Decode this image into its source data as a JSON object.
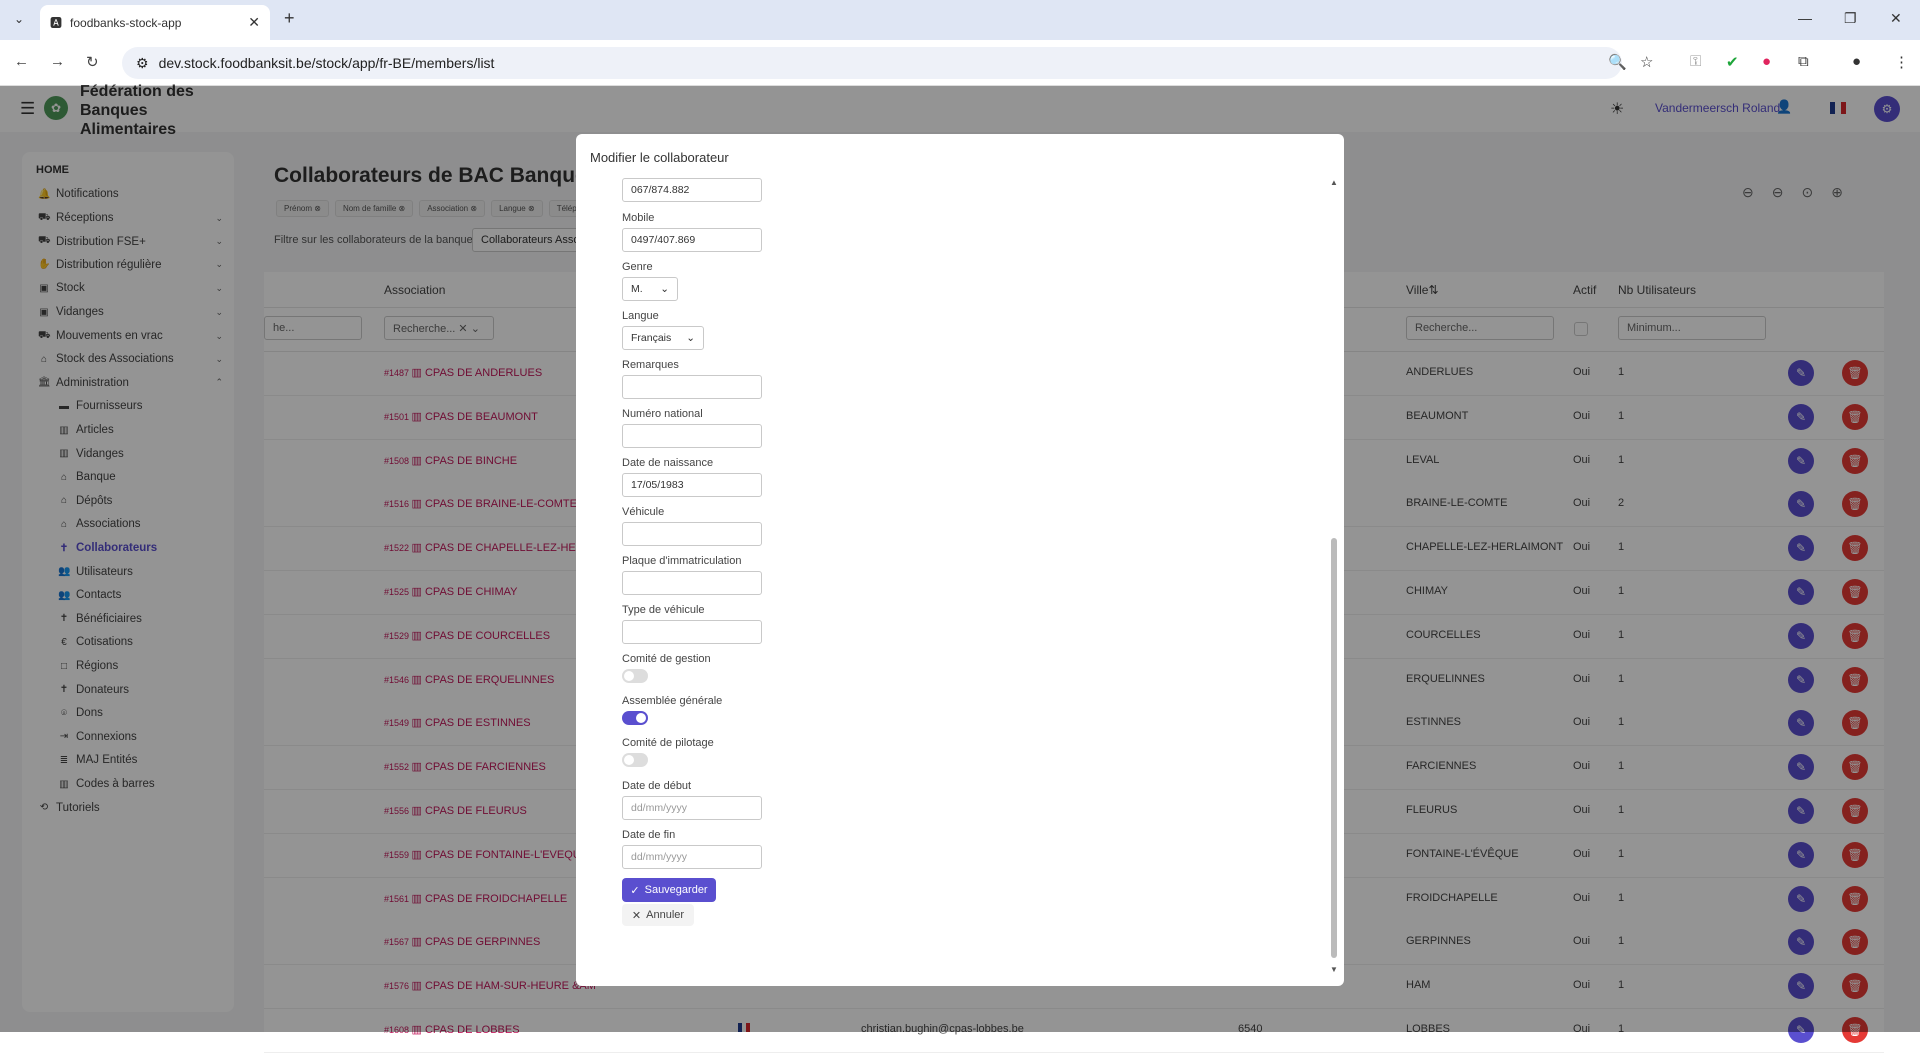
{
  "browser": {
    "tab_title": "foodbanks-stock-app",
    "url": "dev.stock.foodbanksit.be/stock/app/fr-BE/members/list"
  },
  "header": {
    "brand_line1": "Fédération des",
    "brand_line2": "Banques",
    "brand_line3": "Alimentaires",
    "user_name": "Vandermeersch Roland"
  },
  "sidebar": {
    "home": "HOME",
    "items": [
      {
        "label": "Notifications",
        "icon": "bell-icon",
        "sub": false,
        "chevron": false
      },
      {
        "label": "Réceptions",
        "icon": "truck-in-icon",
        "sub": false,
        "chevron": true
      },
      {
        "label": "Distribution FSE+",
        "icon": "truck-icon",
        "sub": false,
        "chevron": true
      },
      {
        "label": "Distribution régulière",
        "icon": "hand-icon",
        "sub": false,
        "chevron": true
      },
      {
        "label": "Stock",
        "icon": "box-icon",
        "sub": false,
        "chevron": true
      },
      {
        "label": "Vidanges",
        "icon": "box-icon",
        "sub": false,
        "chevron": true
      },
      {
        "label": "Mouvements en vrac",
        "icon": "truck-icon",
        "sub": false,
        "chevron": true
      },
      {
        "label": "Stock des Associations",
        "icon": "warehouse-icon",
        "sub": false,
        "chevron": true
      },
      {
        "label": "Administration",
        "icon": "building-icon",
        "sub": false,
        "chevron": true
      },
      {
        "label": "Fournisseurs",
        "icon": "folder-icon",
        "sub": true,
        "chevron": false
      },
      {
        "label": "Articles",
        "icon": "barcode-icon",
        "sub": true,
        "chevron": false
      },
      {
        "label": "Vidanges",
        "icon": "barcode-icon",
        "sub": true,
        "chevron": false
      },
      {
        "label": "Banque",
        "icon": "bank-icon",
        "sub": true,
        "chevron": false
      },
      {
        "label": "Dépôts",
        "icon": "warehouse-icon",
        "sub": true,
        "chevron": false
      },
      {
        "label": "Associations",
        "icon": "warehouse-icon",
        "sub": true,
        "chevron": false
      },
      {
        "label": "Collaborateurs",
        "icon": "person-icon",
        "sub": true,
        "chevron": false,
        "active": true
      },
      {
        "label": "Utilisateurs",
        "icon": "users-icon",
        "sub": true,
        "chevron": false
      },
      {
        "label": "Contacts",
        "icon": "users-icon",
        "sub": true,
        "chevron": false
      },
      {
        "label": "Bénéficiaires",
        "icon": "person-icon",
        "sub": true,
        "chevron": false
      },
      {
        "label": "Cotisations",
        "icon": "euro-icon",
        "sub": true,
        "chevron": false
      },
      {
        "label": "Régions",
        "icon": "square-icon",
        "sub": true,
        "chevron": false
      },
      {
        "label": "Donateurs",
        "icon": "person-icon",
        "sub": true,
        "chevron": false
      },
      {
        "label": "Dons",
        "icon": "gift-icon",
        "sub": true,
        "chevron": false
      },
      {
        "label": "Connexions",
        "icon": "login-icon",
        "sub": true,
        "chevron": false
      },
      {
        "label": "MAJ Entités",
        "icon": "database-icon",
        "sub": true,
        "chevron": false
      },
      {
        "label": "Codes à barres",
        "icon": "barcode-icon",
        "sub": true,
        "chevron": false
      },
      {
        "label": "Tutoriels",
        "icon": "tutorial-icon",
        "sub": false,
        "chevron": false
      }
    ]
  },
  "main": {
    "title": "Collaborateurs de BAC Banque",
    "chips": [
      "Prénom",
      "Nom de famille",
      "Association",
      "Langue",
      "Télép"
    ],
    "filter_label": "Filtre sur les collaborateurs de la banque",
    "filter_value": "Collaborateurs Asso",
    "columns": {
      "association": "Association",
      "ville": "Ville",
      "actif": "Actif",
      "nb_users": "Nb Utilisateurs"
    },
    "search_placeholder": "Recherche...",
    "search_placeholder_short": "he...",
    "min_placeholder": "Minimum...",
    "rows": [
      {
        "code": "#1487",
        "name": "CPAS DE ANDERLUES",
        "ville": "ANDERLUES",
        "actif": "Oui",
        "nb": "1"
      },
      {
        "code": "#1501",
        "name": "CPAS DE BEAUMONT",
        "ville": "BEAUMONT",
        "actif": "Oui",
        "nb": "1"
      },
      {
        "code": "#1508",
        "name": "CPAS DE BINCHE",
        "ville": "LEVAL",
        "actif": "Oui",
        "nb": "1"
      },
      {
        "code": "#1516",
        "name": "CPAS DE BRAINE-LE-COMTE",
        "ville": "BRAINE-LE-COMTE",
        "actif": "Oui",
        "nb": "2"
      },
      {
        "code": "#1522",
        "name": "CPAS DE CHAPELLE-LEZ-HERLAIM",
        "ville": "CHAPELLE-LEZ-HERLAIMONT",
        "actif": "Oui",
        "nb": "1"
      },
      {
        "code": "#1525",
        "name": "CPAS DE CHIMAY",
        "ville": "CHIMAY",
        "actif": "Oui",
        "nb": "1"
      },
      {
        "code": "#1529",
        "name": "CPAS DE COURCELLES",
        "ville": "COURCELLES",
        "actif": "Oui",
        "nb": "1"
      },
      {
        "code": "#1546",
        "name": "CPAS DE ERQUELINNES",
        "ville": "ERQUELINNES",
        "actif": "Oui",
        "nb": "1"
      },
      {
        "code": "#1549",
        "name": "CPAS DE ESTINNES",
        "ville": "ESTINNES",
        "actif": "Oui",
        "nb": "1"
      },
      {
        "code": "#1552",
        "name": "CPAS DE FARCIENNES",
        "ville": "FARCIENNES",
        "actif": "Oui",
        "nb": "1"
      },
      {
        "code": "#1556",
        "name": "CPAS DE FLEURUS",
        "ville": "FLEURUS",
        "actif": "Oui",
        "nb": "1"
      },
      {
        "code": "#1559",
        "name": "CPAS DE FONTAINE-L'EVEQUE",
        "ville": "FONTAINE-L'ÉVÊQUE",
        "actif": "Oui",
        "nb": "1"
      },
      {
        "code": "#1561",
        "name": "CPAS DE FROIDCHAPELLE",
        "ville": "FROIDCHAPELLE",
        "actif": "Oui",
        "nb": "1"
      },
      {
        "code": "#1567",
        "name": "CPAS DE GERPINNES",
        "ville": "GERPINNES",
        "actif": "Oui",
        "nb": "1"
      },
      {
        "code": "#1576",
        "name": "CPAS DE HAM-SUR-HEURE &AM",
        "ville": "HAM",
        "actif": "Oui",
        "nb": "1"
      },
      {
        "code": "#1608",
        "name": "CPAS DE LOBBES",
        "ville": "LOBBES",
        "actif": "Oui",
        "nb": "1",
        "email": "christian.bughin@cpas-lobbes.be",
        "cp": "6540"
      }
    ]
  },
  "modal": {
    "title": "Modifier le collaborateur",
    "phone_value": "067/874.882",
    "mobile_label": "Mobile",
    "mobile_value": "0497/407.869",
    "genre_label": "Genre",
    "genre_value": "M.",
    "langue_label": "Langue",
    "langue_value": "Français",
    "remarques_label": "Remarques",
    "numero_label": "Numéro national",
    "naissance_label": "Date de naissance",
    "naissance_value": "17/05/1983",
    "vehicule_label": "Véhicule",
    "plaque_label": "Plaque d'immatriculation",
    "type_label": "Type de véhicule",
    "comite_gestion_label": "Comité de gestion",
    "comite_gestion_on": false,
    "assemblee_label": "Assemblée générale",
    "assemblee_on": true,
    "comite_pilotage_label": "Comité de pilotage",
    "comite_pilotage_on": false,
    "date_debut_label": "Date de début",
    "date_fin_label": "Date de fin",
    "date_placeholder": "dd/mm/yyyy",
    "save_label": "Sauvegarder",
    "cancel_label": "Annuler"
  },
  "colors": {
    "accent": "#5a4fcf",
    "danger": "#e53935",
    "assoc": "#c2185b"
  }
}
